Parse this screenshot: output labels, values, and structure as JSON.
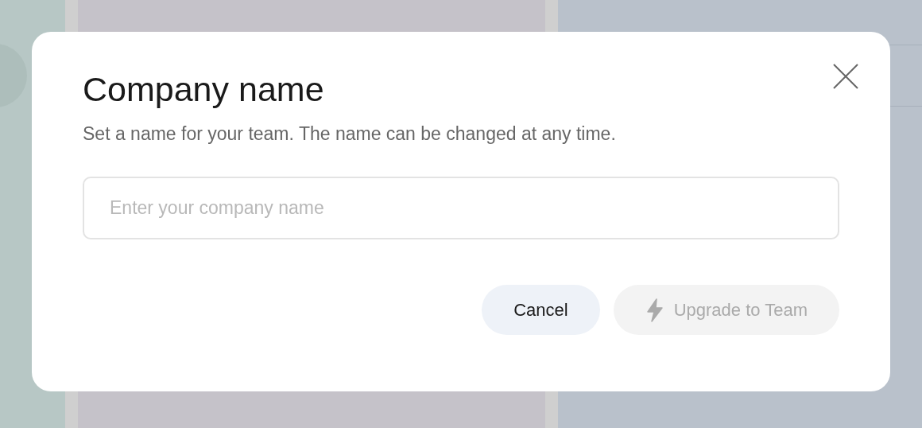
{
  "dialog": {
    "title": "Company name",
    "description": "Set a name for your team. The name can be changed at any time.",
    "field": {
      "placeholder": "Enter your company name"
    },
    "buttons": [
      {
        "label": "Cancel",
        "kind": "secondary",
        "disabled": false
      },
      {
        "label": "Upgrade to Team",
        "kind": "primary",
        "disabled": true
      }
    ]
  }
}
